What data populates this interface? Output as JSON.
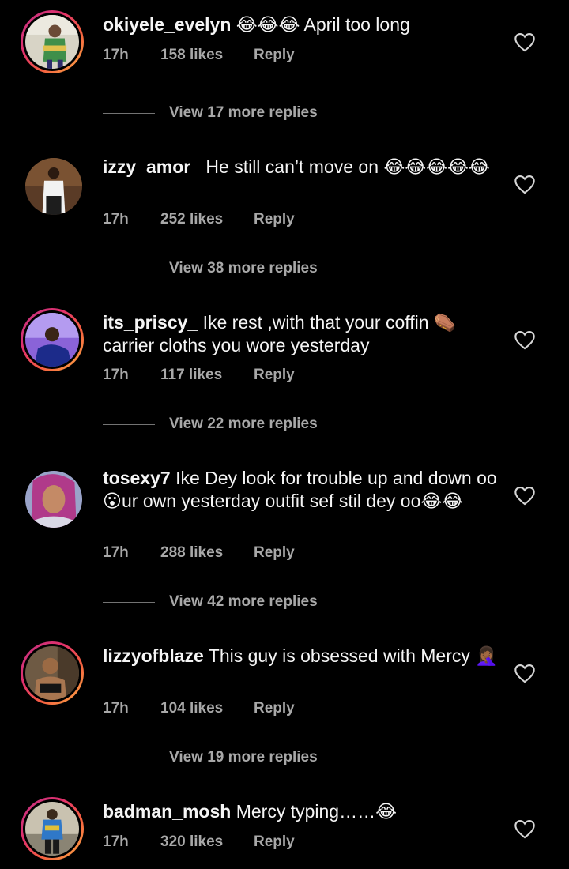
{
  "comments": [
    {
      "username": "okiyele_evelyn",
      "text": "😂😂😂 April too long",
      "time": "17h",
      "likes": "158 likes",
      "reply_label": "Reply",
      "view_replies": "View 17 more replies",
      "story_ring": true
    },
    {
      "username": "izzy_amor_",
      "text": "He still can’t move on 😂😂😂😂😂",
      "time": "17h",
      "likes": "252 likes",
      "reply_label": "Reply",
      "view_replies": "View 38 more replies",
      "story_ring": false
    },
    {
      "username": "its_priscy_",
      "text": "Ike rest ,with that your coffin ⚰️ carrier cloths you wore yesterday",
      "time": "17h",
      "likes": "117 likes",
      "reply_label": "Reply",
      "view_replies": "View 22 more replies",
      "story_ring": true
    },
    {
      "username": "tosexy7",
      "text": "Ike Dey look for trouble up and down oo😮ur own yesterday outfit sef stil dey oo😂😂",
      "time": "17h",
      "likes": "288 likes",
      "reply_label": "Reply",
      "view_replies": "View 42 more replies",
      "story_ring": false
    },
    {
      "username": "lizzyofblaze",
      "text": "This guy is obsessed with Mercy 🤦🏾‍♀️",
      "time": "17h",
      "likes": "104 likes",
      "reply_label": "Reply",
      "view_replies": "View 19 more replies",
      "story_ring": true
    },
    {
      "username": "badman_mosh",
      "text": "Mercy typing……😂",
      "time": "17h",
      "likes": "320 likes",
      "reply_label": "Reply",
      "story_ring": true
    }
  ],
  "colors": {
    "background": "#000000",
    "primary_text": "#f5f5f5",
    "secondary_text": "#a8a8a8",
    "story_ring_start": "#c13584",
    "story_ring_end": "#fcaf45"
  },
  "icons": {
    "like": "heart-outline-icon"
  }
}
